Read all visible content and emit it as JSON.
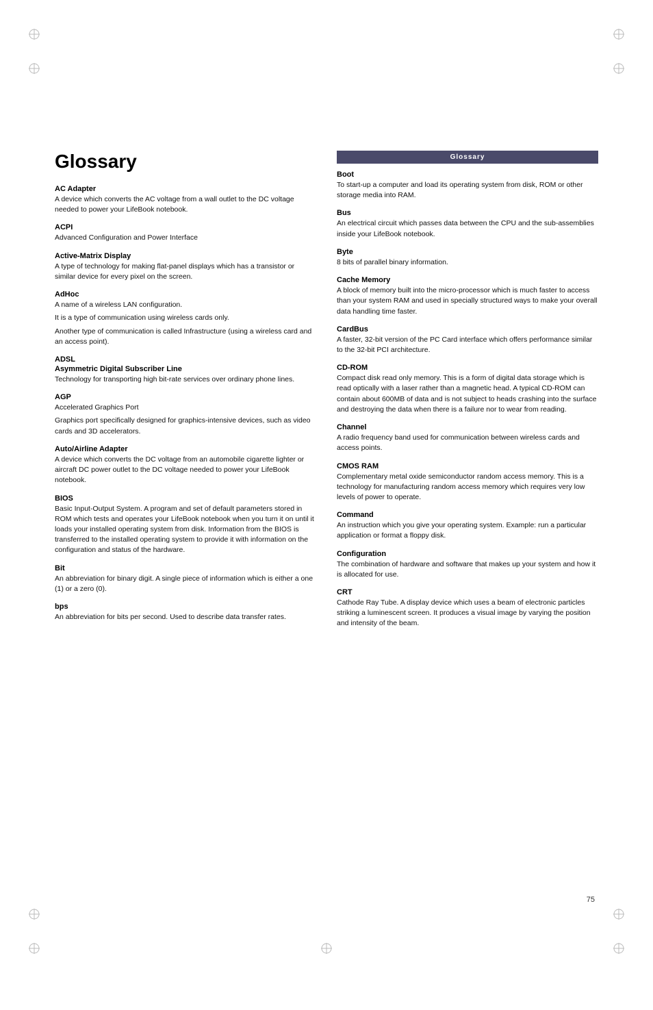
{
  "page": {
    "title": "Glossary",
    "page_number": "75",
    "header_bar_text": "Glossary"
  },
  "left_column": {
    "terms": [
      {
        "name": "AC Adapter",
        "definition": "A device which converts the AC voltage from a wall outlet to the DC voltage needed to power your LifeBook notebook."
      },
      {
        "name": "ACPI",
        "definition": "Advanced Configuration and Power Interface"
      },
      {
        "name": "Active-Matrix Display",
        "definition": "A type of technology for making flat-panel displays which has a transistor or similar device for every pixel on the screen."
      },
      {
        "name": "AdHoc",
        "definition": "A name of a wireless LAN configuration.",
        "extra_lines": [
          "It is a type of communication using wireless cards only.",
          "Another type of communication is called Infrastructure (using a wireless card and an access point)."
        ]
      },
      {
        "name": "ADSL",
        "sub_name": "Asymmetric Digital Subscriber Line",
        "definition": "Technology for transporting high bit-rate services over ordinary phone lines."
      },
      {
        "name": "AGP",
        "definition": "Accelerated Graphics Port",
        "extra_lines": [
          "Graphics port specifically designed for graphics-intensive devices, such as video cards and 3D accelerators."
        ]
      },
      {
        "name": "Auto/Airline Adapter",
        "definition": "A device which converts the DC voltage from an automobile cigarette lighter or aircraft DC power outlet to the DC voltage needed to power your LifeBook notebook."
      },
      {
        "name": "BIOS",
        "definition": "Basic Input-Output System. A program and set of default parameters stored in ROM which tests and operates your LifeBook notebook when you turn it on until it loads your installed operating system from disk. Information from the BIOS is transferred to the installed operating system to provide it with information on the configuration and status of the hardware."
      },
      {
        "name": "Bit",
        "definition": "An abbreviation for binary digit. A single piece of information which is either a one (1) or a zero (0)."
      },
      {
        "name": "bps",
        "definition": "An abbreviation for bits per second. Used to describe data transfer rates."
      }
    ]
  },
  "right_column": {
    "terms": [
      {
        "name": "Boot",
        "definition": "To start-up a computer and load its operating system from disk, ROM or other storage media into RAM."
      },
      {
        "name": "Bus",
        "definition": "An electrical circuit which passes data between the CPU and the sub-assemblies inside your LifeBook notebook."
      },
      {
        "name": "Byte",
        "definition": "8 bits of parallel binary information."
      },
      {
        "name": "Cache Memory",
        "definition": "A block of memory built into the micro-processor which is much faster to access than your system RAM and used in specially structured ways to make your overall data handling time faster."
      },
      {
        "name": "CardBus",
        "definition": "A faster, 32-bit version of the PC Card interface which offers performance similar to the 32-bit PCI architecture."
      },
      {
        "name": "CD-ROM",
        "definition": "Compact disk read only memory. This is a form of digital data storage which is read optically with a laser rather than a magnetic head. A typical CD-ROM can contain about 600MB of data and is not subject to heads crashing into the surface and destroying the data when there is a failure nor to wear from reading."
      },
      {
        "name": "Channel",
        "definition": "A radio frequency band used for communication between wireless cards and access points."
      },
      {
        "name": "CMOS RAM",
        "definition": "Complementary metal oxide semiconductor random access memory. This is a technology for manufacturing random access memory which requires very low levels of power to operate."
      },
      {
        "name": "Command",
        "definition": "An instruction which you give your operating system. Example: run a particular application or format a floppy disk."
      },
      {
        "name": "Configuration",
        "definition": "The combination of hardware and software that makes up your system and how it is allocated for use."
      },
      {
        "name": "CRT",
        "definition": "Cathode Ray Tube. A display device which uses a beam of electronic particles striking a luminescent screen. It produces a visual image by varying the position and intensity of the beam."
      }
    ]
  }
}
